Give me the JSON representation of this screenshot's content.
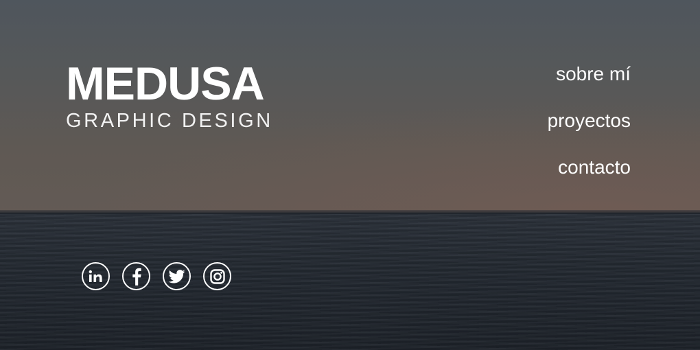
{
  "brand": {
    "title": "MEDUSA",
    "subtitle": "GRAPHIC DESIGN"
  },
  "nav": {
    "items": [
      {
        "label": "sobre mí"
      },
      {
        "label": "proyectos"
      },
      {
        "label": "contacto"
      }
    ]
  },
  "social": {
    "icons": [
      "linkedin-icon",
      "facebook-icon",
      "twitter-icon",
      "instagram-icon"
    ],
    "linkedin_text": "in"
  },
  "colors": {
    "text": "#ffffff",
    "sky": "#565859",
    "sea": "#242a32"
  }
}
